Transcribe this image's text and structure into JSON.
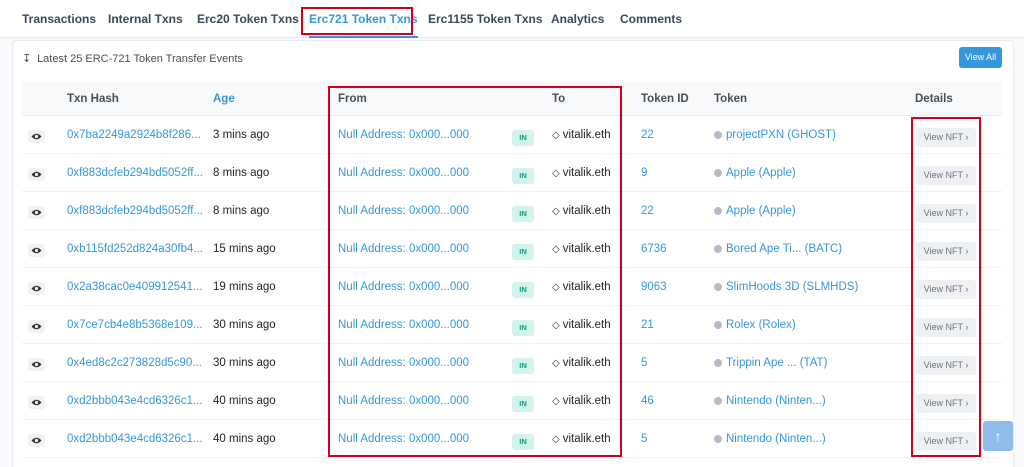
{
  "tabs": [
    "Transactions",
    "Internal Txns",
    "Erc20 Token Txns",
    "Erc721 Token Txns",
    "Erc1155 Token Txns",
    "Analytics",
    "Comments"
  ],
  "active_tab": "Erc721 Token Txns",
  "summary": "Latest 25 ERC-721 Token Transfer Events",
  "view_all": "View All",
  "columns": {
    "txn_hash": "Txn Hash",
    "age": "Age",
    "from": "From",
    "to": "To",
    "token_id": "Token ID",
    "token": "Token",
    "details": "Details"
  },
  "direction_badge": "IN",
  "view_nft": "View NFT",
  "rows": [
    {
      "hash": "0x7ba2249a2924b8f286...",
      "age": "3 mins ago",
      "from": "Null Address: 0x000...000",
      "direction": "IN",
      "to": "vitalik.eth",
      "token_id": "22",
      "token": "projectPXN (GHOST)",
      "details": "View NFT"
    },
    {
      "hash": "0xf883dcfeb294bd5052ff...",
      "age": "8 mins ago",
      "from": "Null Address: 0x000...000",
      "direction": "IN",
      "to": "vitalik.eth",
      "token_id": "9",
      "token": "Apple (Apple)",
      "details": "View NFT"
    },
    {
      "hash": "0xf883dcfeb294bd5052ff...",
      "age": "8 mins ago",
      "from": "Null Address: 0x000...000",
      "direction": "IN",
      "to": "vitalik.eth",
      "token_id": "22",
      "token": "Apple (Apple)",
      "details": "View NFT"
    },
    {
      "hash": "0xb115fd252d824a30fb4...",
      "age": "15 mins ago",
      "from": "Null Address: 0x000...000",
      "direction": "IN",
      "to": "vitalik.eth",
      "token_id": "6736",
      "token": "Bored Ape Ti... (BATC)",
      "details": "View NFT"
    },
    {
      "hash": "0x2a38cac0e409912541...",
      "age": "19 mins ago",
      "from": "Null Address: 0x000...000",
      "direction": "IN",
      "to": "vitalik.eth",
      "token_id": "9063",
      "token": "SlimHoods 3D (SLMHDS)",
      "details": "View NFT"
    },
    {
      "hash": "0x7ce7cb4e8b5368e109...",
      "age": "30 mins ago",
      "from": "Null Address: 0x000...000",
      "direction": "IN",
      "to": "vitalik.eth",
      "token_id": "21",
      "token": "Rolex (Rolex)",
      "details": "View NFT"
    },
    {
      "hash": "0x4ed8c2c273828d5c90...",
      "age": "30 mins ago",
      "from": "Null Address: 0x000...000",
      "direction": "IN",
      "to": "vitalik.eth",
      "token_id": "5",
      "token": "Trippin Ape ... (TAT)",
      "details": "View NFT"
    },
    {
      "hash": "0xd2bbb043e4cd6326c1...",
      "age": "40 mins ago",
      "from": "Null Address: 0x000...000",
      "direction": "IN",
      "to": "vitalik.eth",
      "token_id": "46",
      "token": "Nintendo (Ninten...)",
      "details": "View NFT"
    },
    {
      "hash": "0xd2bbb043e4cd6326c1...",
      "age": "40 mins ago",
      "from": "Null Address: 0x000...000",
      "direction": "IN",
      "to": "vitalik.eth",
      "token_id": "5",
      "token": "Nintendo (Ninten...)",
      "details": "View NFT"
    }
  ],
  "colors": {
    "link": "#3498db",
    "highlight_box": "#d0021b",
    "in_badge_bg": "#d2f4ec",
    "in_badge_text": "#00a186"
  },
  "icons": {
    "eye": "eye-icon",
    "sort": "sort-desc-icon",
    "token": "token-icon",
    "ens": "ens-icon",
    "chevron": "chevron-right-icon",
    "back_to_top": "arrow-up-icon"
  }
}
